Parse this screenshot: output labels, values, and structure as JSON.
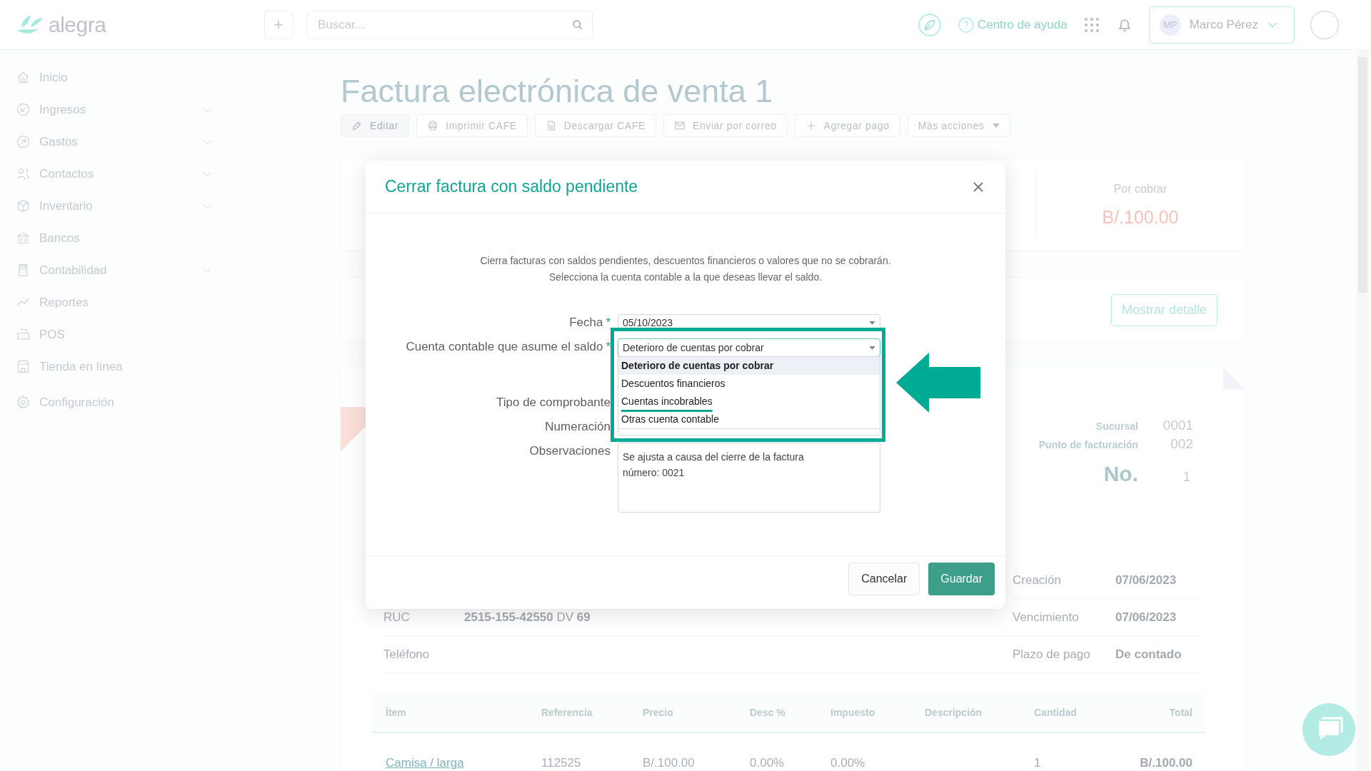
{
  "header": {
    "logo": "alegra",
    "add_button": "+",
    "search": {
      "placeholder": "Buscar..."
    },
    "help": "Centro de ayuda",
    "user": {
      "initials": "MP",
      "name": "Marco Pérez"
    }
  },
  "sidebar": {
    "items": [
      {
        "label": "Inicio",
        "has_submenu": false
      },
      {
        "label": "Ingresos",
        "has_submenu": true
      },
      {
        "label": "Gastos",
        "has_submenu": true
      },
      {
        "label": "Contactos",
        "has_submenu": true
      },
      {
        "label": "Inventario",
        "has_submenu": true
      },
      {
        "label": "Bancos",
        "has_submenu": false
      },
      {
        "label": "Contabilidad",
        "has_submenu": true
      },
      {
        "label": "Reportes",
        "has_submenu": false
      },
      {
        "label": "POS",
        "has_submenu": false
      },
      {
        "label": "Tienda en línea",
        "has_submenu": false
      },
      {
        "label": "Configuración",
        "has_submenu": false
      }
    ]
  },
  "page": {
    "title": "Factura electrónica de venta 1",
    "actions": [
      {
        "label": "Editar",
        "disabled": true,
        "kind": "button"
      },
      {
        "label": "Imprimir CAFE",
        "disabled": false,
        "kind": "button"
      },
      {
        "label": "Descargar CAFE",
        "disabled": false,
        "kind": "button"
      },
      {
        "label": "Enviar por correo",
        "disabled": false,
        "kind": "button"
      },
      {
        "label": "Agregar pago",
        "disabled": false,
        "kind": "button"
      },
      {
        "label": "Más acciones",
        "disabled": false,
        "kind": "menu"
      }
    ],
    "summary": {
      "label": "Por cobrar",
      "amount": "B/.100.00"
    },
    "detail_button": "Mostrar detalle",
    "invoice": {
      "branch_label": "Sucursal",
      "branch": "0001",
      "point_label": "Punto de facturación",
      "point": "002",
      "number_label": "No.",
      "number": "1",
      "client": [
        {
          "label": "RUC",
          "value": "**2515-155-42550** DV **69**"
        },
        {
          "label": "Teléfono"
        }
      ],
      "dates": [
        {
          "label": "Creación",
          "value": "07/06/2023"
        },
        {
          "label": "Vencimiento",
          "value": "07/06/2023"
        },
        {
          "label": "Plazo de pago",
          "value": "De contado"
        }
      ],
      "table": {
        "columns": [
          "Ítem",
          "Referencia",
          "Precio",
          "Desc %",
          "Impuesto",
          "Descripción",
          "Cantidad",
          "Total"
        ],
        "rows": [
          {
            "item": "Camisa / larga",
            "reference": "112525",
            "price": "B/.100.00",
            "discount": "0.00%",
            "tax": "0.00%",
            "quantity": "1",
            "total": "B/.100.00"
          }
        ]
      }
    }
  },
  "dialog": {
    "title": "Cerrar factura con saldo pendiente",
    "description": [
      "Cierra facturas con saldos pendientes, descuentos financieros o valores que no se cobrarán.",
      "Selecciona la cuenta contable a la que deseas llevar el saldo."
    ],
    "fields": [
      {
        "label": "Fecha",
        "required": true,
        "kind": "select",
        "value": "05/10/2023"
      },
      {
        "label": "Cuenta contable que asume el saldo",
        "required": true,
        "kind": "select",
        "value": "Deterioro de cuentas por cobrar",
        "open": true,
        "options": [
          {
            "label": "Deterioro de cuentas por cobrar",
            "selected": true,
            "underlined": false
          },
          {
            "label": "Descuentos financieros",
            "selected": false,
            "underlined": false
          },
          {
            "label": "Cuentas incobrables",
            "selected": false,
            "underlined": true
          },
          {
            "label": "Otras cuenta contable",
            "selected": false,
            "underlined": false
          }
        ]
      },
      {
        "label": "Tipo de comprobante",
        "required": false,
        "kind": "covered"
      },
      {
        "label": "Numeración",
        "required": false,
        "kind": "covered"
      },
      {
        "label": "Observaciones",
        "required": false,
        "kind": "textarea",
        "value": "Se ajusta a causa del cierre de la factura número: 0021"
      }
    ],
    "required_mark": "*",
    "cancel": "Cancelar",
    "save": "Guardar"
  }
}
